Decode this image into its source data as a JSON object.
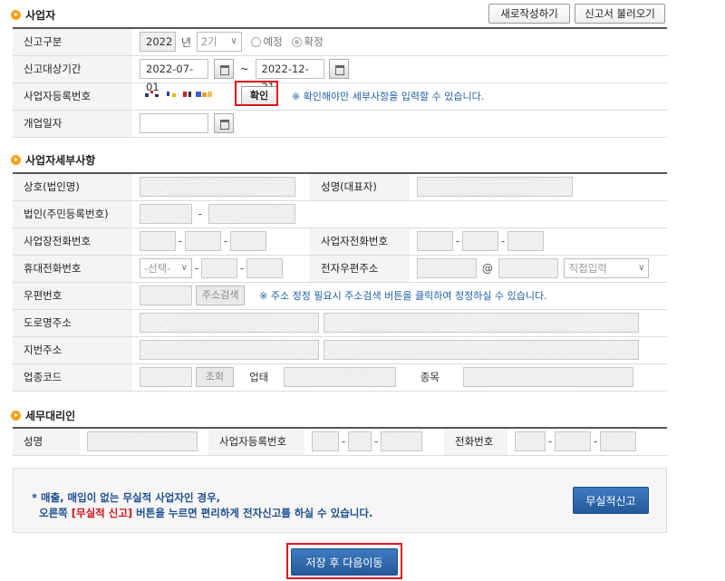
{
  "sections": {
    "business": "사업자",
    "business_detail": "사업자세부사항",
    "agent": "세무대리인"
  },
  "top_buttons": {
    "new": "새로작성하기",
    "load": "신고서 불러오기"
  },
  "business": {
    "report_type_label": "신고구분",
    "year": "2022",
    "year_unit": "년",
    "period": "2기",
    "radio_prelim": "예정",
    "radio_final": "확정",
    "period_label": "신고대상기간",
    "date_from": "2022-07-01",
    "tilde": "~",
    "date_to": "2022-12-31",
    "regno_label": "사업자등록번호",
    "confirm_button": "확인",
    "confirm_note": "※ 확인해야만 세부사항을 입력할 수 있습니다.",
    "open_date_label": "개업일자"
  },
  "detail": {
    "company_label": "상호(법인명)",
    "ceo_label": "성명(대표자)",
    "corp_no_label": "법인(주민등록번호)",
    "biz_phone_label": "사업장전화번호",
    "biz_tel_label": "사업자전화번호",
    "mobile_label": "휴대전화번호",
    "mobile_select": "-선택-",
    "email_label": "전자우편주소",
    "at": "@",
    "email_domain_select": "직접입력",
    "zip_label": "우편번호",
    "zip_search_button": "주소검색",
    "zip_note": "※ 주소 정정 필요시 주소검색 버튼을 클릭하여 정정하실 수 있습니다.",
    "road_addr_label": "도로명주소",
    "lot_addr_label": "지번주소",
    "industry_code_label": "업종코드",
    "lookup_button": "조회",
    "business_type_label": "업태",
    "item_label": "종목"
  },
  "agent": {
    "name_label": "성명",
    "regno_label": "사업자등록번호",
    "phone_label": "전화번호"
  },
  "info": {
    "line1": "* 매출, 매입이 없는 무실적 사업자인 경우,",
    "line2_pre": "오른쪽 ",
    "line2_red": "[무실적 신고]",
    "line2_post": " 버튼을 누르면 편리하게 전자신고를 하실 수 있습니다.",
    "no_record_button": "무실적신고"
  },
  "save_button": "저장 후 다음이동",
  "colors": {
    "accent_blue": "#245a9b",
    "highlight_red": "#e0151d",
    "section_dot": "#f4a21b",
    "note_blue": "#1f5fa8"
  }
}
